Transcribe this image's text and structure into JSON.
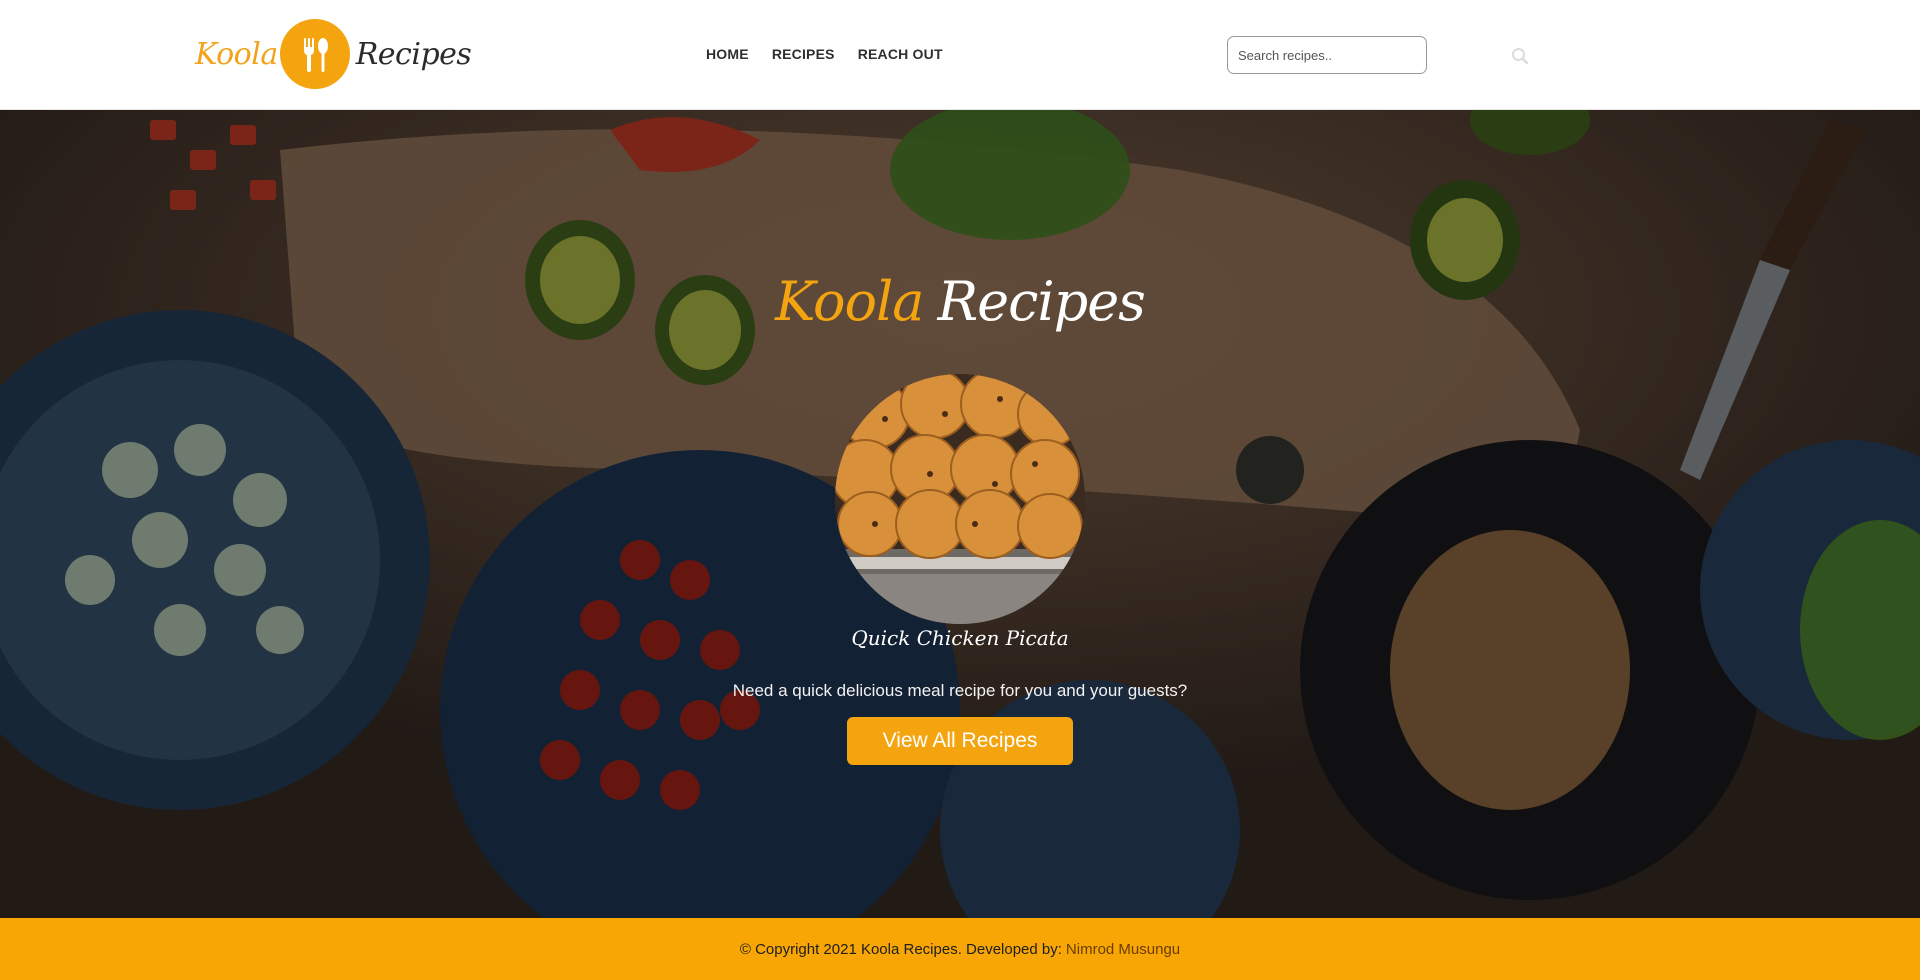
{
  "colors": {
    "brand_orange": "#f4a40f",
    "header_bg": "#ffffff",
    "footer_bg": "#f7a606",
    "text_dark": "#2b2b2b",
    "text_light": "#ffffff"
  },
  "header": {
    "logo": {
      "word_left": "Koola",
      "word_right": "Recipes",
      "icon": "fork-and-spoon-icon"
    },
    "nav": [
      {
        "label": "HOME"
      },
      {
        "label": "RECIPES"
      },
      {
        "label": "REACH OUT"
      }
    ],
    "search": {
      "placeholder": "Search recipes..",
      "value": "",
      "icon": "search-icon"
    }
  },
  "hero": {
    "title_left": "Koola",
    "title_right": "Recipes",
    "featured_dish": "Quick Chicken Picata",
    "tagline": "Need a quick delicious meal recipe for you and your guests?",
    "cta_label": "View All Recipes"
  },
  "footer": {
    "text": "© Copyright 2021 Koola Recipes. Developed by:",
    "developer": "Nimrod Musungu"
  }
}
